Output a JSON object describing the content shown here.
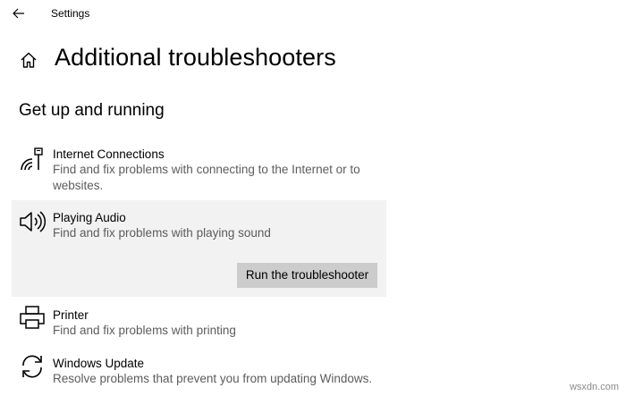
{
  "window": {
    "title": "Settings",
    "back_icon": "arrow-left-icon"
  },
  "header": {
    "home_icon": "home-icon",
    "title": "Additional troubleshooters"
  },
  "section": {
    "heading": "Get up and running"
  },
  "items": [
    {
      "icon": "network-icon",
      "name": "Internet Connections",
      "description_line1": "Find and fix problems with connecting to the Internet or to",
      "description_line2": "websites."
    },
    {
      "icon": "speaker-icon",
      "name": "Playing Audio",
      "description": "Find and fix problems with playing sound",
      "button": "Run the troubleshooter",
      "selected": true
    },
    {
      "icon": "printer-icon",
      "name": "Printer",
      "description": "Find and fix problems with printing"
    },
    {
      "icon": "sync-icon",
      "name": "Windows Update",
      "description": "Resolve problems that prevent you from updating Windows."
    }
  ],
  "watermark": "wsxdn.com",
  "colors": {
    "selected_bg": "#f2f2f2",
    "button_bg": "#cccccc",
    "description_text": "#5c5c5c"
  }
}
